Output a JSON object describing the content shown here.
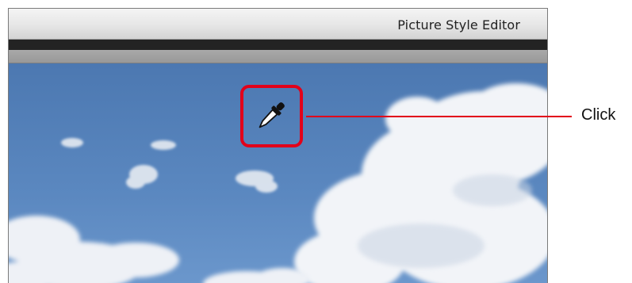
{
  "window": {
    "title": "Picture Style Editor"
  },
  "annotation": {
    "callout_label": "Click",
    "highlight_color": "#e2001a"
  },
  "canvas": {
    "cursor_icon": "eyedropper-icon",
    "image_subject": "blue sky with white clouds"
  }
}
